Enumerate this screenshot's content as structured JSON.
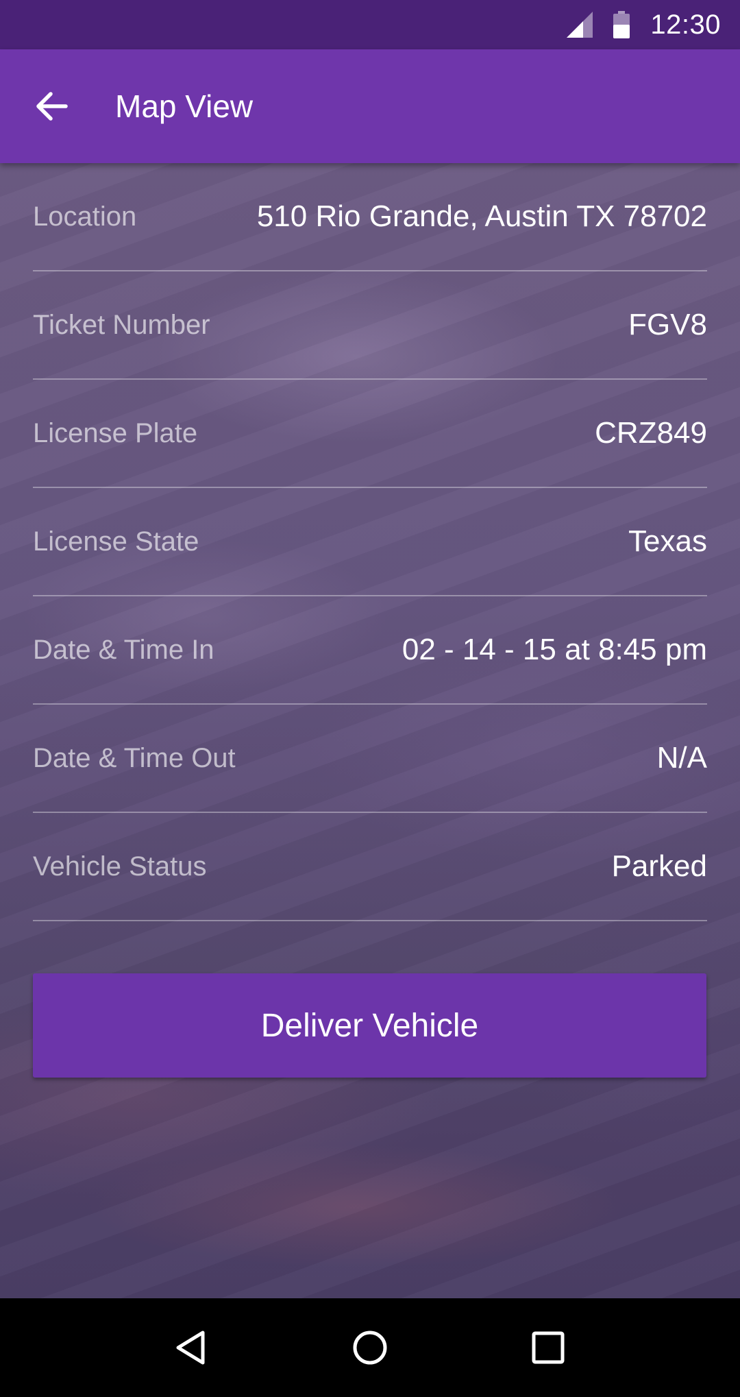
{
  "status_bar": {
    "time": "12:30",
    "icons": [
      "signal-icon",
      "battery-icon"
    ]
  },
  "app_bar": {
    "back_icon": "arrow-back-icon",
    "title": "Map View"
  },
  "details": [
    {
      "label": "Location",
      "value": "510 Rio Grande, Austin TX 78702"
    },
    {
      "label": "Ticket Number",
      "value": "FGV8"
    },
    {
      "label": "License Plate",
      "value": "CRZ849"
    },
    {
      "label": "License State",
      "value": "Texas"
    },
    {
      "label": "Date & Time In",
      "value": "02 - 14 - 15 at 8:45 pm"
    },
    {
      "label": "Date & Time Out",
      "value": "N/A"
    },
    {
      "label": "Vehicle Status",
      "value": "Parked"
    }
  ],
  "actions": {
    "deliver_label": "Deliver Vehicle"
  },
  "nav_bar": {
    "icons": [
      "back-triangle-icon",
      "home-circle-icon",
      "recents-square-icon"
    ]
  },
  "colors": {
    "status_bar": "#4a2277",
    "app_bar": "#6f36ab",
    "button": "#6c35aa"
  }
}
